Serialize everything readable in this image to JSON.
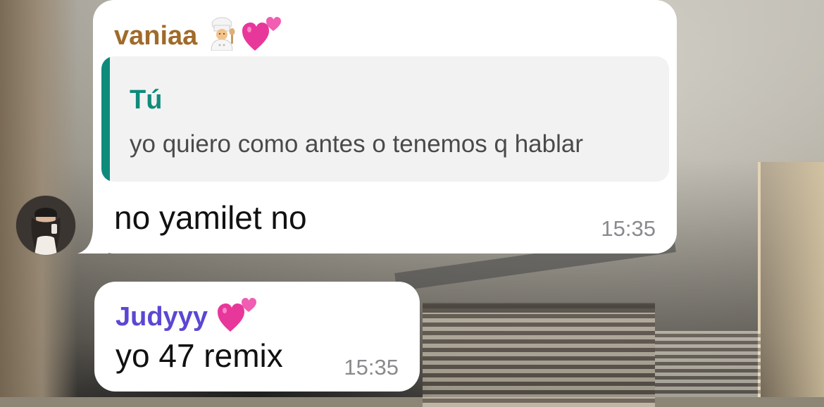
{
  "messages": [
    {
      "sender": "vaniaa",
      "sender_emojis": [
        "cook-emoji",
        "two-hearts-emoji"
      ],
      "quote": {
        "author": "Tú",
        "text": "yo quiero como antes o tenemos q hablar"
      },
      "text": "no yamilet no",
      "time": "15:35",
      "sender_color": "#a06a29"
    },
    {
      "sender": "Judyyy",
      "sender_emojis": [
        "two-hearts-emoji"
      ],
      "text": "yo 47 remix",
      "time": "15:35",
      "sender_color": "#5b47d3"
    }
  ],
  "colors": {
    "bubble": "#ffffff",
    "quote_accent": "#0f8b7c",
    "timestamp": "#8a8a8e"
  }
}
